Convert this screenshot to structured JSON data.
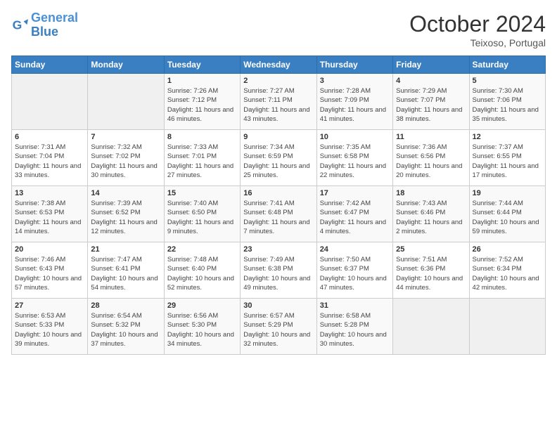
{
  "header": {
    "logo_general": "General",
    "logo_blue": "Blue",
    "month_title": "October 2024",
    "location": "Teixoso, Portugal"
  },
  "days_of_week": [
    "Sunday",
    "Monday",
    "Tuesday",
    "Wednesday",
    "Thursday",
    "Friday",
    "Saturday"
  ],
  "weeks": [
    [
      null,
      null,
      {
        "day": 1,
        "sunrise": "7:26 AM",
        "sunset": "7:12 PM",
        "daylight": "11 hours and 46 minutes."
      },
      {
        "day": 2,
        "sunrise": "7:27 AM",
        "sunset": "7:11 PM",
        "daylight": "11 hours and 43 minutes."
      },
      {
        "day": 3,
        "sunrise": "7:28 AM",
        "sunset": "7:09 PM",
        "daylight": "11 hours and 41 minutes."
      },
      {
        "day": 4,
        "sunrise": "7:29 AM",
        "sunset": "7:07 PM",
        "daylight": "11 hours and 38 minutes."
      },
      {
        "day": 5,
        "sunrise": "7:30 AM",
        "sunset": "7:06 PM",
        "daylight": "11 hours and 35 minutes."
      }
    ],
    [
      {
        "day": 6,
        "sunrise": "7:31 AM",
        "sunset": "7:04 PM",
        "daylight": "11 hours and 33 minutes."
      },
      {
        "day": 7,
        "sunrise": "7:32 AM",
        "sunset": "7:02 PM",
        "daylight": "11 hours and 30 minutes."
      },
      {
        "day": 8,
        "sunrise": "7:33 AM",
        "sunset": "7:01 PM",
        "daylight": "11 hours and 27 minutes."
      },
      {
        "day": 9,
        "sunrise": "7:34 AM",
        "sunset": "6:59 PM",
        "daylight": "11 hours and 25 minutes."
      },
      {
        "day": 10,
        "sunrise": "7:35 AM",
        "sunset": "6:58 PM",
        "daylight": "11 hours and 22 minutes."
      },
      {
        "day": 11,
        "sunrise": "7:36 AM",
        "sunset": "6:56 PM",
        "daylight": "11 hours and 20 minutes."
      },
      {
        "day": 12,
        "sunrise": "7:37 AM",
        "sunset": "6:55 PM",
        "daylight": "11 hours and 17 minutes."
      }
    ],
    [
      {
        "day": 13,
        "sunrise": "7:38 AM",
        "sunset": "6:53 PM",
        "daylight": "11 hours and 14 minutes."
      },
      {
        "day": 14,
        "sunrise": "7:39 AM",
        "sunset": "6:52 PM",
        "daylight": "11 hours and 12 minutes."
      },
      {
        "day": 15,
        "sunrise": "7:40 AM",
        "sunset": "6:50 PM",
        "daylight": "11 hours and 9 minutes."
      },
      {
        "day": 16,
        "sunrise": "7:41 AM",
        "sunset": "6:48 PM",
        "daylight": "11 hours and 7 minutes."
      },
      {
        "day": 17,
        "sunrise": "7:42 AM",
        "sunset": "6:47 PM",
        "daylight": "11 hours and 4 minutes."
      },
      {
        "day": 18,
        "sunrise": "7:43 AM",
        "sunset": "6:46 PM",
        "daylight": "11 hours and 2 minutes."
      },
      {
        "day": 19,
        "sunrise": "7:44 AM",
        "sunset": "6:44 PM",
        "daylight": "10 hours and 59 minutes."
      }
    ],
    [
      {
        "day": 20,
        "sunrise": "7:46 AM",
        "sunset": "6:43 PM",
        "daylight": "10 hours and 57 minutes."
      },
      {
        "day": 21,
        "sunrise": "7:47 AM",
        "sunset": "6:41 PM",
        "daylight": "10 hours and 54 minutes."
      },
      {
        "day": 22,
        "sunrise": "7:48 AM",
        "sunset": "6:40 PM",
        "daylight": "10 hours and 52 minutes."
      },
      {
        "day": 23,
        "sunrise": "7:49 AM",
        "sunset": "6:38 PM",
        "daylight": "10 hours and 49 minutes."
      },
      {
        "day": 24,
        "sunrise": "7:50 AM",
        "sunset": "6:37 PM",
        "daylight": "10 hours and 47 minutes."
      },
      {
        "day": 25,
        "sunrise": "7:51 AM",
        "sunset": "6:36 PM",
        "daylight": "10 hours and 44 minutes."
      },
      {
        "day": 26,
        "sunrise": "7:52 AM",
        "sunset": "6:34 PM",
        "daylight": "10 hours and 42 minutes."
      }
    ],
    [
      {
        "day": 27,
        "sunrise": "6:53 AM",
        "sunset": "5:33 PM",
        "daylight": "10 hours and 39 minutes."
      },
      {
        "day": 28,
        "sunrise": "6:54 AM",
        "sunset": "5:32 PM",
        "daylight": "10 hours and 37 minutes."
      },
      {
        "day": 29,
        "sunrise": "6:56 AM",
        "sunset": "5:30 PM",
        "daylight": "10 hours and 34 minutes."
      },
      {
        "day": 30,
        "sunrise": "6:57 AM",
        "sunset": "5:29 PM",
        "daylight": "10 hours and 32 minutes."
      },
      {
        "day": 31,
        "sunrise": "6:58 AM",
        "sunset": "5:28 PM",
        "daylight": "10 hours and 30 minutes."
      },
      null,
      null
    ]
  ]
}
